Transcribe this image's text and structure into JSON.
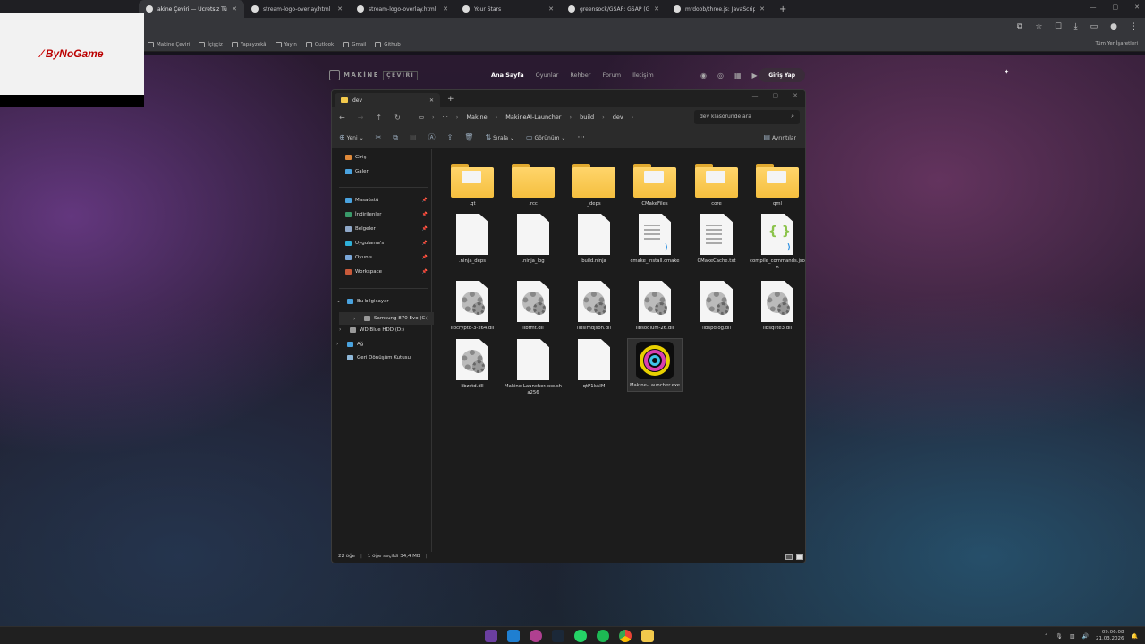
{
  "browser": {
    "tabs": [
      {
        "label": "akine Çeviri — Ücretsiz Türk",
        "active": true
      },
      {
        "label": "stream-logo-overlay.html",
        "active": false
      },
      {
        "label": "stream-logo-overlay.html",
        "active": false
      },
      {
        "label": "Your Stars",
        "active": false
      },
      {
        "label": "greensock/GSAP: GSAP (Green",
        "active": false
      },
      {
        "label": "mrdoob/three.js: JavaScript 3D",
        "active": false
      }
    ],
    "bookmarks": [
      "Makine Çeviri",
      "İçişçiz",
      "Yapayzekâ",
      "Yayın",
      "Outlook",
      "Gmail",
      "Github"
    ],
    "bookmarks_right": "Tüm Yer İşaretleri"
  },
  "overlay": {
    "logo_prefix": "By",
    "logo_main": "NoGame"
  },
  "site": {
    "brand": "MAKİNE",
    "brand_tag": "ÇEVİRİ",
    "nav": [
      "Ana Sayfa",
      "Oyunlar",
      "Rehber",
      "Forum",
      "İletişim"
    ],
    "login": "Giriş Yap"
  },
  "explorer": {
    "tab_title": "dev",
    "breadcrumbs": [
      "Makine",
      "MakineAI-Launcher",
      "build",
      "dev"
    ],
    "search_placeholder": "dev klasöründe ara",
    "commands": {
      "new": "Yeni",
      "sort": "Sırala",
      "view": "Görünüm",
      "details": "Ayrıntılar"
    },
    "sidebar": {
      "quick": [
        "Giriş",
        "Galeri"
      ],
      "pinned": [
        "Masaüstü",
        "İndirilenler",
        "Belgeler",
        "Uygulama's",
        "Oyun's",
        "Workspace"
      ],
      "this_pc": "Bu bilgisayar",
      "drives": [
        "Samsung 870 Evo (C:)",
        "WD Blue HDD (D:)"
      ],
      "network": "Ağ",
      "recycle": "Geri Dönüşüm Kutusu"
    },
    "items": [
      {
        "name": ".qt",
        "kind": "folder"
      },
      {
        "name": ".rcc",
        "kind": "folder"
      },
      {
        "name": "_deps",
        "kind": "folder"
      },
      {
        "name": "CMakeFiles",
        "kind": "folder"
      },
      {
        "name": "core",
        "kind": "folder"
      },
      {
        "name": "qml",
        "kind": "folder"
      },
      {
        "name": ".ninja_deps",
        "kind": "file"
      },
      {
        "name": ".ninja_log",
        "kind": "file"
      },
      {
        "name": "build.ninja",
        "kind": "file"
      },
      {
        "name": "cmake_install.cmake",
        "kind": "cmake"
      },
      {
        "name": "CMakeCache.txt",
        "kind": "text"
      },
      {
        "name": "compile_commands.json",
        "kind": "json"
      },
      {
        "name": "libcrypto-3-x64.dll",
        "kind": "dll"
      },
      {
        "name": "libfmt.dll",
        "kind": "dll"
      },
      {
        "name": "libsimdjson.dll",
        "kind": "dll"
      },
      {
        "name": "libsodium-26.dll",
        "kind": "dll"
      },
      {
        "name": "libspdlog.dll",
        "kind": "dll"
      },
      {
        "name": "libsqlite3.dll",
        "kind": "dll"
      },
      {
        "name": "libzstd.dll",
        "kind": "dll"
      },
      {
        "name": "Makine-Launcher.exe.sha256",
        "kind": "file"
      },
      {
        "name": "qtP1kAIM",
        "kind": "file"
      },
      {
        "name": "Makine-Launcher.exe",
        "kind": "exe",
        "selected": true
      }
    ],
    "status": {
      "count": "22 öğe",
      "selection": "1 öğe seçildi  34,4 MB"
    }
  },
  "taskbar": {
    "time": "09:06:08",
    "date": "21.03.2026"
  }
}
